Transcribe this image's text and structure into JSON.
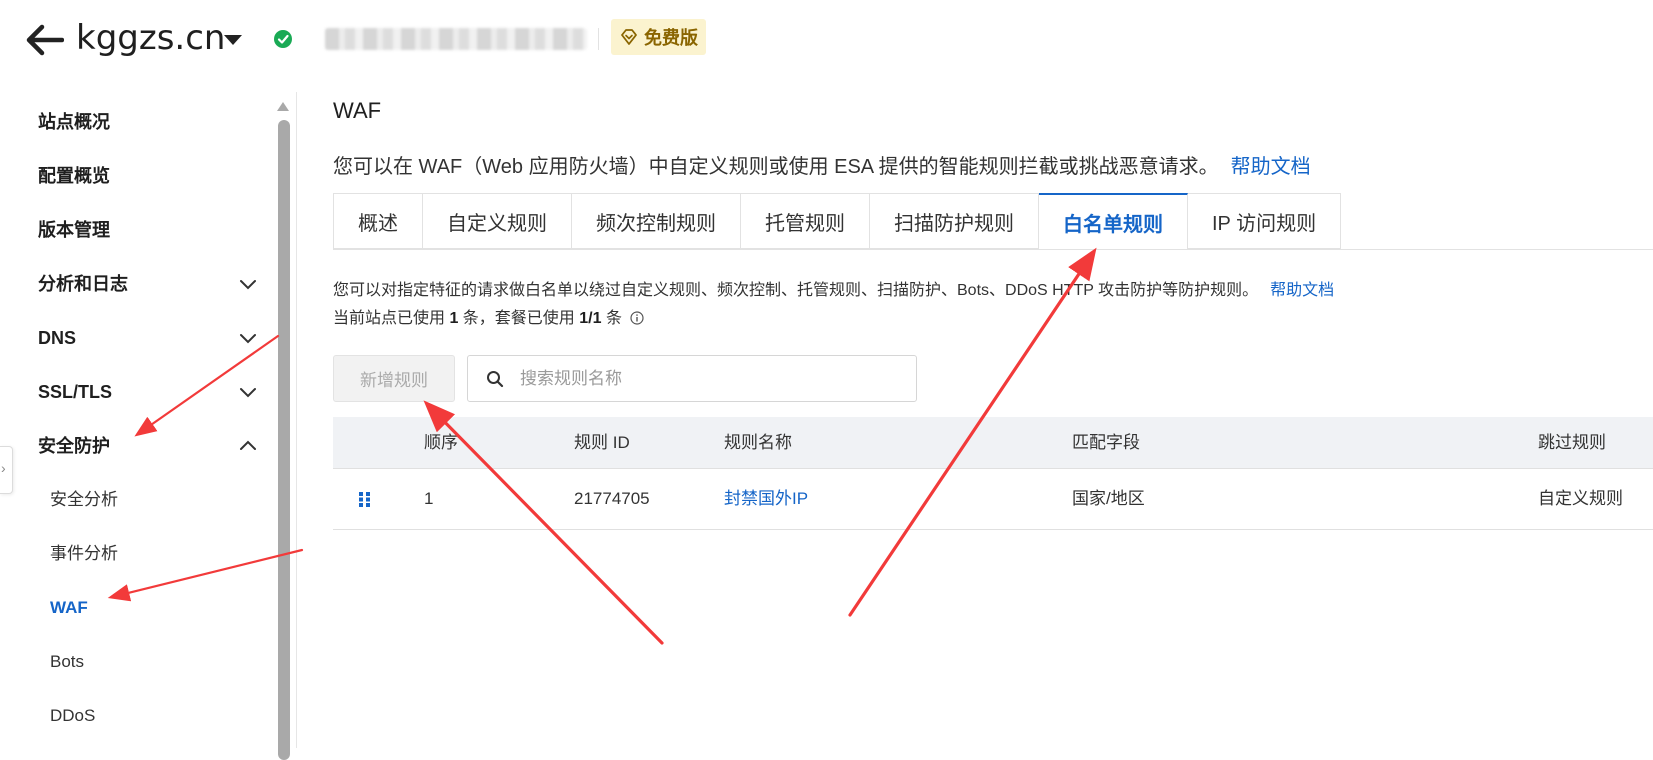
{
  "header": {
    "site_name": "kggzs.cn",
    "free_badge": "免费版"
  },
  "sidebar": {
    "items": [
      {
        "label": "站点概况"
      },
      {
        "label": "配置概览"
      },
      {
        "label": "版本管理"
      },
      {
        "label": "分析和日志",
        "expanded": false
      },
      {
        "label": "DNS",
        "expanded": false
      },
      {
        "label": "SSL/TLS",
        "expanded": false
      },
      {
        "label": "安全防护",
        "expanded": true
      }
    ],
    "sub_items": [
      {
        "label": "安全分析"
      },
      {
        "label": "事件分析"
      },
      {
        "label": "WAF",
        "active": true
      },
      {
        "label": "Bots"
      },
      {
        "label": "DDoS"
      }
    ]
  },
  "main": {
    "title": "WAF",
    "intro": "您可以在 WAF（Web 应用防火墙）中自定义规则或使用 ESA 提供的智能规则拦截或挑战恶意请求。",
    "help_link": "帮助文档",
    "tabs": [
      {
        "label": "概述"
      },
      {
        "label": "自定义规则"
      },
      {
        "label": "频次控制规则"
      },
      {
        "label": "托管规则"
      },
      {
        "label": "扫描防护规则"
      },
      {
        "label": "白名单规则",
        "active": true
      },
      {
        "label": "IP 访问规则"
      }
    ],
    "desc": {
      "line1": "您可以对指定特征的请求做白名单以绕过自定义规则、频次控制、托管规则、扫描防护、Bots、DDoS HTTP 攻击防护等防护规则。",
      "help_link": "帮助文档",
      "usage_prefix": "当前站点已使用 ",
      "usage_site_count": "1",
      "usage_mid": " 条，套餐已使用 ",
      "usage_plan": "1/1",
      "usage_suffix": " 条"
    },
    "add_button": "新增规则",
    "search_placeholder": "搜索规则名称",
    "table": {
      "columns": [
        "顺序",
        "规则 ID",
        "规则名称",
        "匹配字段",
        "跳过规则"
      ],
      "rows": [
        {
          "order": "1",
          "rule_id": "21774705",
          "name": "封禁国外IP",
          "match_field": "国家/地区",
          "skip_rules": "自定义规则"
        }
      ]
    }
  },
  "colors": {
    "accent": "#1565c8",
    "status_ok": "#1aaa55",
    "badge_bg": "#fbf3cf",
    "annotation_arrow": "#f23a3a"
  }
}
